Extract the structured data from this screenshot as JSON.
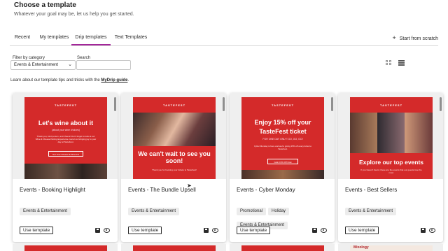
{
  "header": {
    "title": "Choose a template",
    "subtitle": "Whatever your goal may be, let us help you get started."
  },
  "tabs": [
    {
      "label": "Recent"
    },
    {
      "label": "My templates"
    },
    {
      "label": "Drip templates",
      "active": true
    },
    {
      "label": "Text Templates"
    }
  ],
  "start_from_scratch": "Start from scratch",
  "filter": {
    "category_label": "Filter by category",
    "category_value": "Events & Entertainment",
    "search_label": "Search",
    "search_value": ""
  },
  "learn": {
    "text": "Learn about our template tips and tricks with the",
    "link": "MyDrip guide",
    "suffix": "."
  },
  "colors": {
    "accent": "#a3279a",
    "email_red": "#d42a2a"
  },
  "cards": [
    {
      "title": "Events - Booking Highlight",
      "tags": [
        "Events & Entertainment"
      ],
      "button": "Use template",
      "preview": {
        "logo": "TASTEFEST",
        "headline": "Let's wine about it",
        "subline": "(about your wine choices)",
        "body": "Thank you, kind person, and cheers! Don't forget to look at our Wine & Cheese Pairing Experience. Here's to bringing joy to your day at TasteFest.",
        "cta": "Get Your Cheese & Wine Fix"
      }
    },
    {
      "title": "Events - The Bundle Upsell",
      "tags": [
        "Events & Entertainment"
      ],
      "button": "Use template",
      "preview": {
        "logo": "TASTEFEST",
        "headline": "We can't wait to see you soon!",
        "body": "Thank you for booking your tickets to TasteFest!"
      }
    },
    {
      "title": "Events - Cyber Monday",
      "tags": [
        "Promotional",
        "Holiday",
        "Events & Entertainment"
      ],
      "button": "Use template",
      "preview": {
        "logo": "TASTEFEST",
        "headline": "Enjoy 15% off your TasteFest ticket",
        "subline": "FOR ONE DAY ONLY! GO, GO, GO!",
        "body": "Cyber Monday is here and we're giving 15% off every ticket to TasteFest.",
        "cta": "Grab 15% Off Now"
      }
    },
    {
      "title": "Events - Best Sellers",
      "tags": [
        "Events & Entertainment"
      ],
      "button": "Use template",
      "preview": {
        "logo": "TASTEFEST",
        "headline": "Explore our top events",
        "body": "If you haven't heard, these are the events that our guests love the most."
      }
    }
  ],
  "next_row_label": "Mixology"
}
